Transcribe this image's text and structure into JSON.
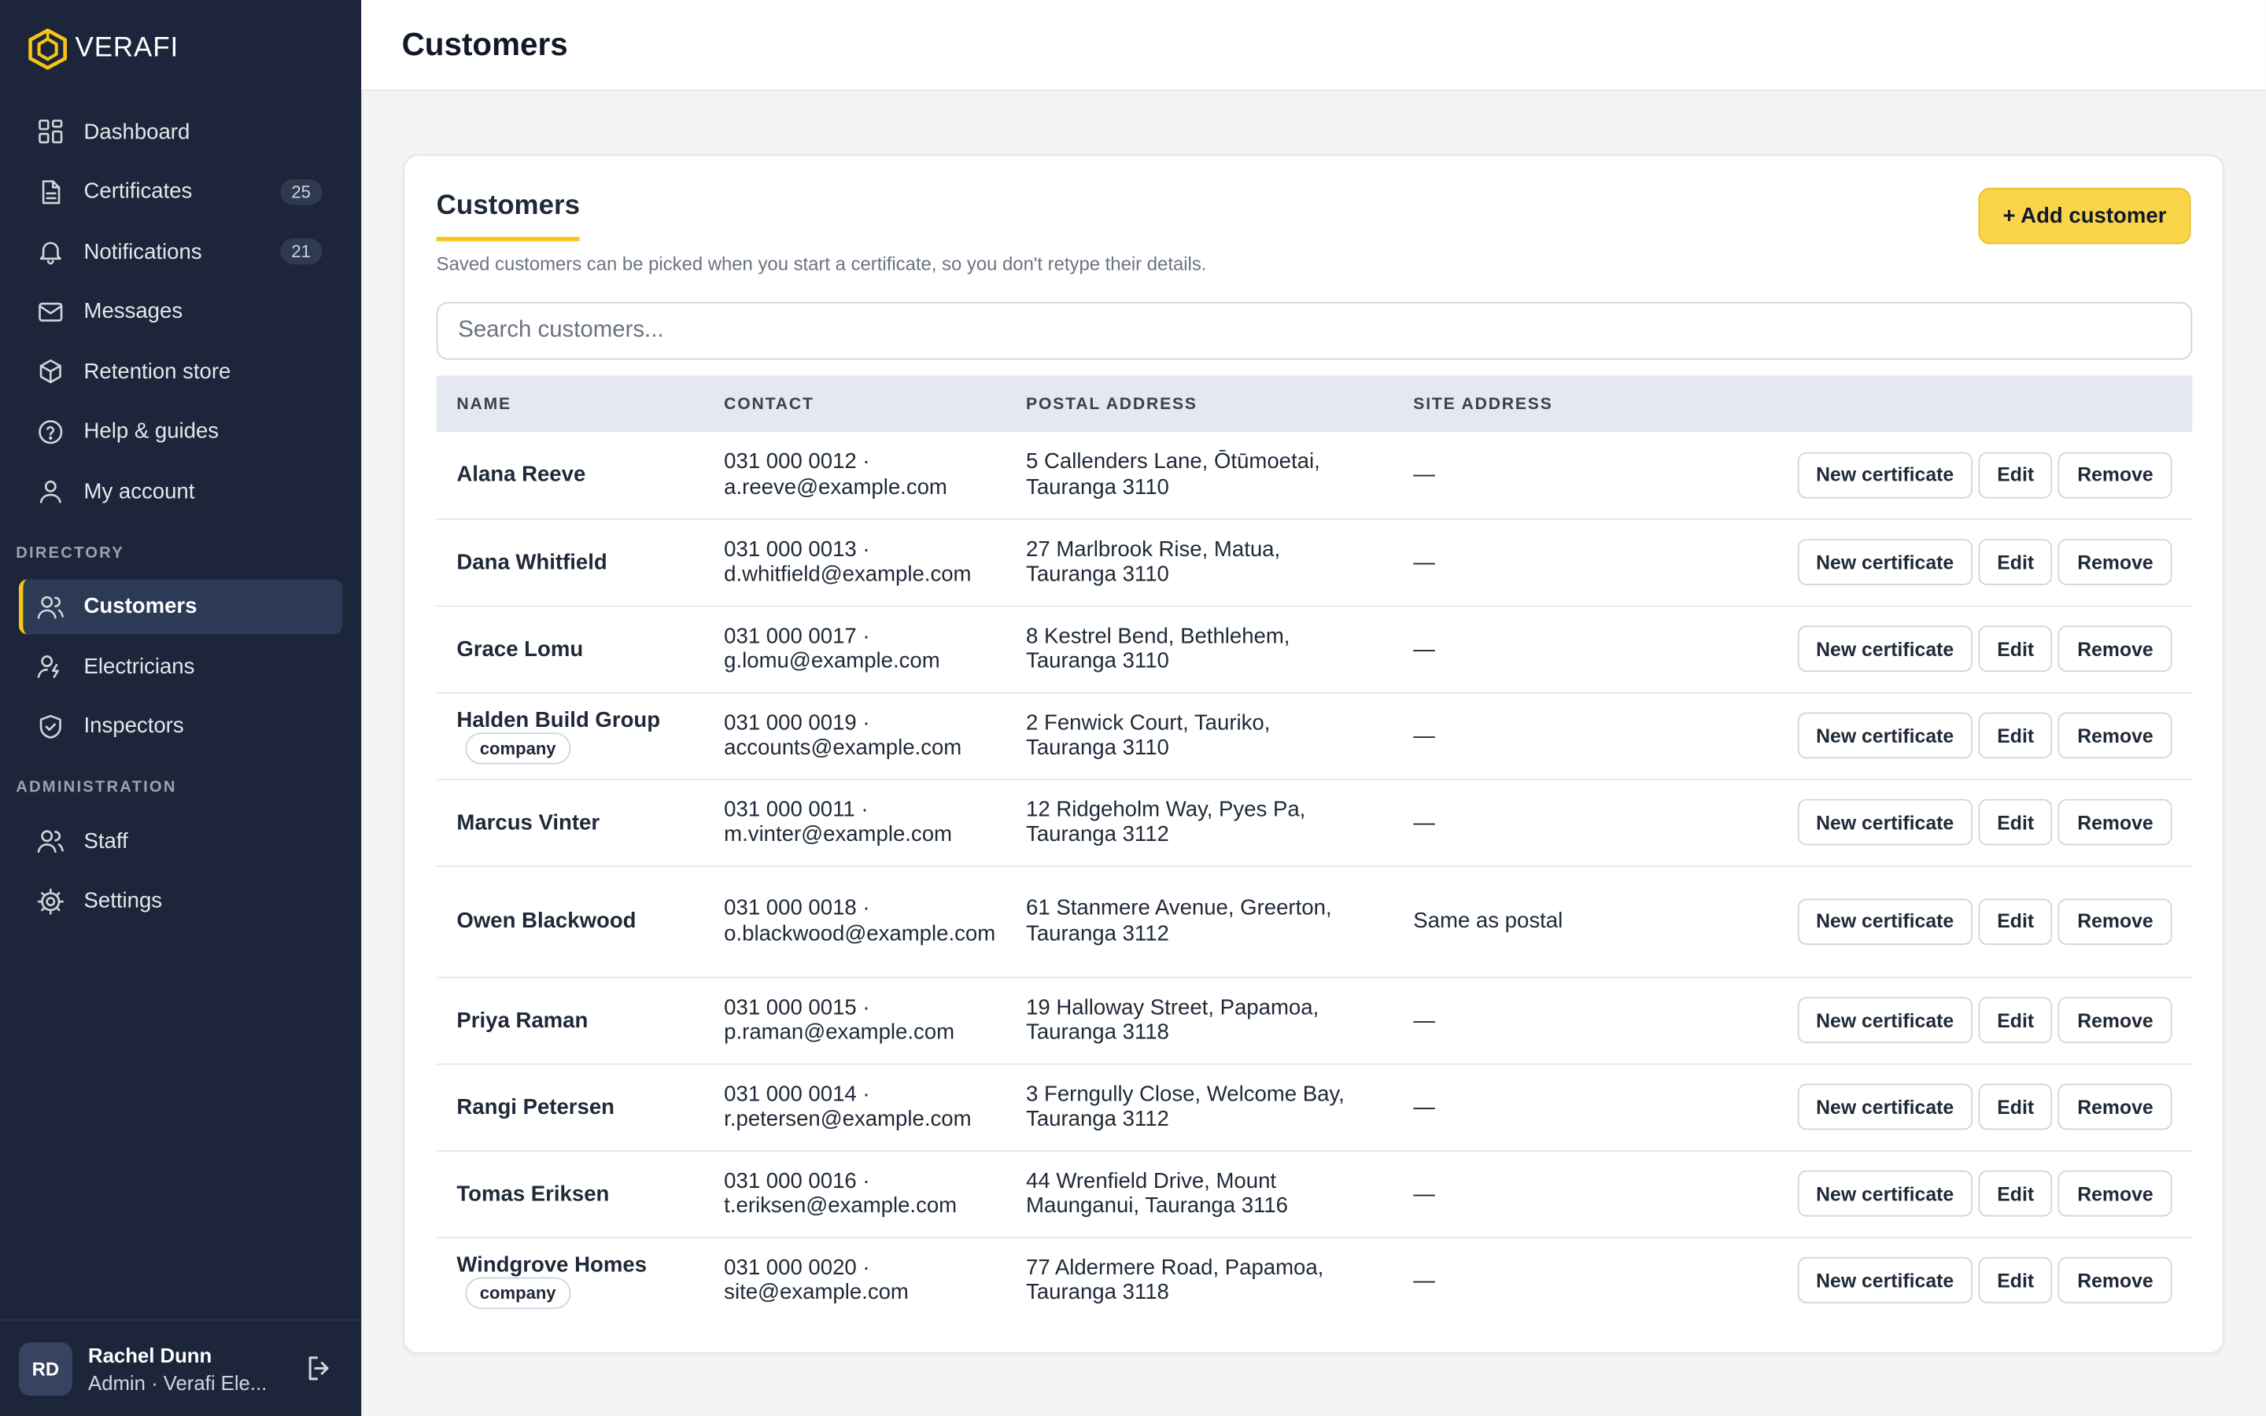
{
  "brand": {
    "name": "VERAFI",
    "accent": "#f5c518"
  },
  "nav": {
    "main": [
      {
        "key": "dashboard",
        "label": "Dashboard",
        "icon": "dashboard-icon",
        "badge": null
      },
      {
        "key": "certificates",
        "label": "Certificates",
        "icon": "document-icon",
        "badge": "25"
      },
      {
        "key": "notifications",
        "label": "Notifications",
        "icon": "bell-icon",
        "badge": "21"
      },
      {
        "key": "messages",
        "label": "Messages",
        "icon": "mail-icon",
        "badge": null
      },
      {
        "key": "retention",
        "label": "Retention store",
        "icon": "box-icon",
        "badge": null
      },
      {
        "key": "help",
        "label": "Help & guides",
        "icon": "help-circle-icon",
        "badge": null
      },
      {
        "key": "account",
        "label": "My account",
        "icon": "user-icon",
        "badge": null
      }
    ],
    "directory_label": "DIRECTORY",
    "directory": [
      {
        "key": "customers",
        "label": "Customers",
        "icon": "users-icon",
        "active": true
      },
      {
        "key": "electricians",
        "label": "Electricians",
        "icon": "electrician-icon",
        "active": false
      },
      {
        "key": "inspectors",
        "label": "Inspectors",
        "icon": "shield-check-icon",
        "active": false
      }
    ],
    "admin_label": "ADMINISTRATION",
    "admin": [
      {
        "key": "staff",
        "label": "Staff",
        "icon": "staff-icon"
      },
      {
        "key": "settings",
        "label": "Settings",
        "icon": "gear-icon"
      }
    ]
  },
  "user": {
    "initials": "RD",
    "name": "Rachel Dunn",
    "role": "Admin · Verafi Ele..."
  },
  "header": {
    "title": "Customers"
  },
  "card": {
    "title": "Customers",
    "subtitle": "Saved customers can be picked when you start a certificate, so you don't retype their details.",
    "add_label": "+ Add customer",
    "search_placeholder": "Search customers..."
  },
  "table": {
    "columns": [
      "NAME",
      "CONTACT",
      "POSTAL ADDRESS",
      "SITE ADDRESS"
    ],
    "actions": {
      "new": "New certificate",
      "edit": "Edit",
      "remove": "Remove"
    },
    "rows": [
      {
        "name": "Alana Reeve",
        "tag": "",
        "phone": "031 000 0012 ·",
        "email": "a.reeve@example.com",
        "addr1": "5 Callenders Lane, Ōtūmoetai,",
        "addr2": "Tauranga 3110",
        "site": "—"
      },
      {
        "name": "Dana Whitfield",
        "tag": "",
        "phone": "031 000 0013 ·",
        "email": "d.whitfield@example.com",
        "addr1": "27 Marlbrook Rise, Matua,",
        "addr2": "Tauranga 3110",
        "site": "—"
      },
      {
        "name": "Grace Lomu",
        "tag": "",
        "phone": "031 000 0017 ·",
        "email": "g.lomu@example.com",
        "addr1": "8 Kestrel Bend, Bethlehem,",
        "addr2": "Tauranga 3110",
        "site": "—"
      },
      {
        "name": "Halden Build Group",
        "tag": "company",
        "phone": "031 000 0019 ·",
        "email": "accounts@example.com",
        "addr1": "2 Fenwick Court, Tauriko,",
        "addr2": "Tauranga 3110",
        "site": "—"
      },
      {
        "name": "Marcus Vinter",
        "tag": "",
        "phone": "031 000 0011 ·",
        "email": "m.vinter@example.com",
        "addr1": "12 Ridgeholm Way, Pyes Pa,",
        "addr2": "Tauranga 3112",
        "site": "—"
      },
      {
        "name": "Owen Blackwood",
        "tag": "",
        "phone": "031 000 0018 ·",
        "email": "o.blackwood@example.com",
        "addr1": "61 Stanmere Avenue, Greerton,",
        "addr2": "Tauranga 3112",
        "site": "Same as postal"
      },
      {
        "name": "Priya Raman",
        "tag": "",
        "phone": "031 000 0015 ·",
        "email": "p.raman@example.com",
        "addr1": "19 Halloway Street, Papamoa,",
        "addr2": "Tauranga 3118",
        "site": "—"
      },
      {
        "name": "Rangi Petersen",
        "tag": "",
        "phone": "031 000 0014 ·",
        "email": "r.petersen@example.com",
        "addr1": "3 Ferngully Close, Welcome Bay,",
        "addr2": "Tauranga 3112",
        "site": "—"
      },
      {
        "name": "Tomas Eriksen",
        "tag": "",
        "phone": "031 000 0016 ·",
        "email": "t.eriksen@example.com",
        "addr1": "44 Wrenfield Drive, Mount",
        "addr2": "Maunganui, Tauranga 3116",
        "site": "—"
      },
      {
        "name": "Windgrove Homes",
        "tag": "company",
        "phone": "031 000 0020 ·",
        "email": "site@example.com",
        "addr1": "77 Aldermere Road, Papamoa,",
        "addr2": "Tauranga 3118",
        "site": "—"
      }
    ]
  }
}
